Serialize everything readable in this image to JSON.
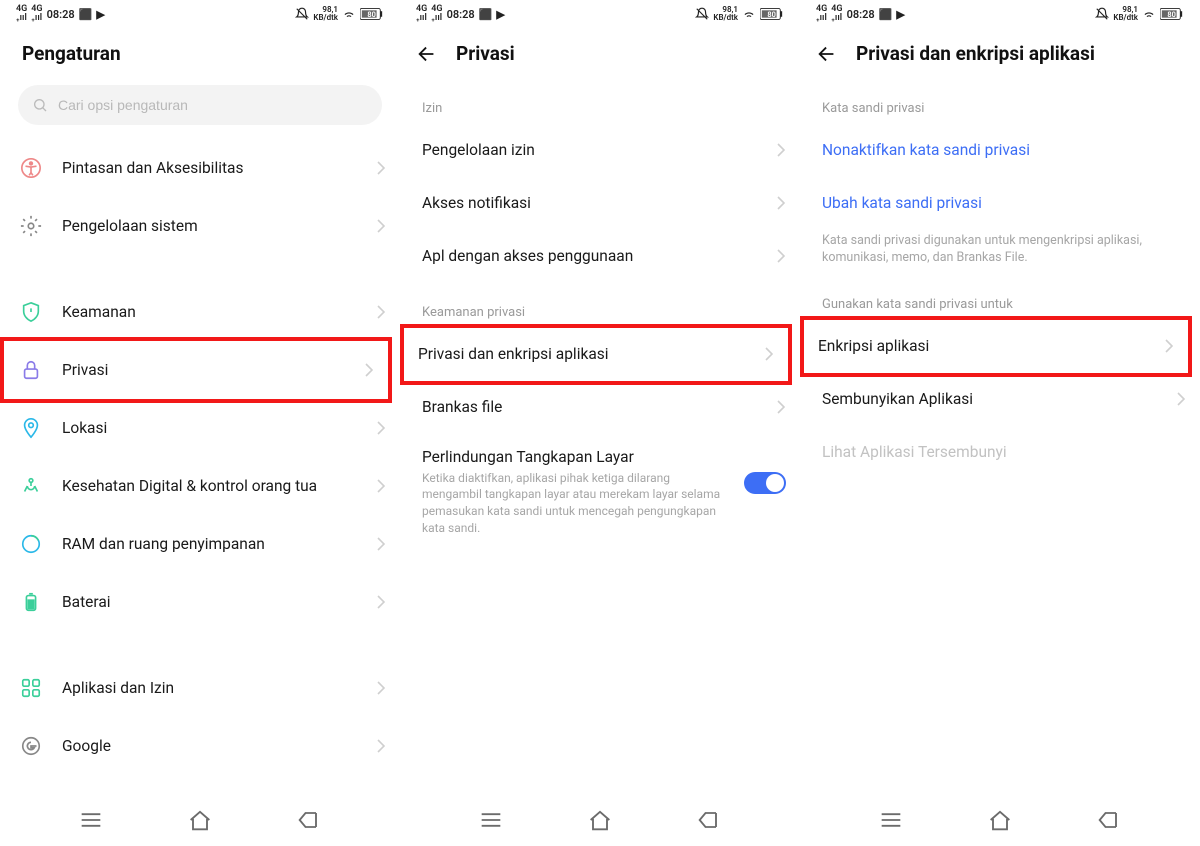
{
  "status": {
    "time": "08:28",
    "net": "98,1",
    "net_unit": "KB/dtk",
    "battery": "80"
  },
  "panel1": {
    "title": "Pengaturan",
    "search_placeholder": "Cari opsi pengaturan",
    "items": [
      {
        "label": "Pintasan dan Aksesibilitas"
      },
      {
        "label": "Pengelolaan sistem"
      },
      {
        "label": "Keamanan"
      },
      {
        "label": "Privasi"
      },
      {
        "label": "Lokasi"
      },
      {
        "label": "Kesehatan Digital & kontrol orang tua"
      },
      {
        "label": "RAM dan ruang penyimpanan"
      },
      {
        "label": "Baterai"
      },
      {
        "label": "Aplikasi dan Izin"
      },
      {
        "label": "Google"
      }
    ]
  },
  "panel2": {
    "title": "Privasi",
    "section1": "Izin",
    "items1": [
      {
        "label": "Pengelolaan izin"
      },
      {
        "label": "Akses notifikasi"
      },
      {
        "label": "Apl dengan akses penggunaan"
      }
    ],
    "section2": "Keamanan privasi",
    "items2": [
      {
        "label": "Privasi dan enkripsi aplikasi"
      },
      {
        "label": "Brankas file"
      }
    ],
    "toggle": {
      "label": "Perlindungan Tangkapan Layar",
      "desc": "Ketika diaktifkan, aplikasi pihak ketiga dilarang mengambil tangkapan layar atau merekam layar selama pemasukan kata sandi untuk mencegah pengungkapan kata sandi."
    }
  },
  "panel3": {
    "title": "Privasi dan enkripsi aplikasi",
    "section1": "Kata sandi privasi",
    "links": [
      {
        "label": "Nonaktifkan kata sandi privasi"
      },
      {
        "label": "Ubah kata sandi privasi"
      }
    ],
    "desc": "Kata sandi privasi digunakan untuk mengenkripsi aplikasi, komunikasi, memo, dan Brankas File.",
    "section2": "Gunakan kata sandi privasi untuk",
    "items": [
      {
        "label": "Enkripsi aplikasi"
      },
      {
        "label": "Sembunyikan Aplikasi"
      },
      {
        "label": "Lihat Aplikasi Tersembunyi"
      }
    ]
  }
}
